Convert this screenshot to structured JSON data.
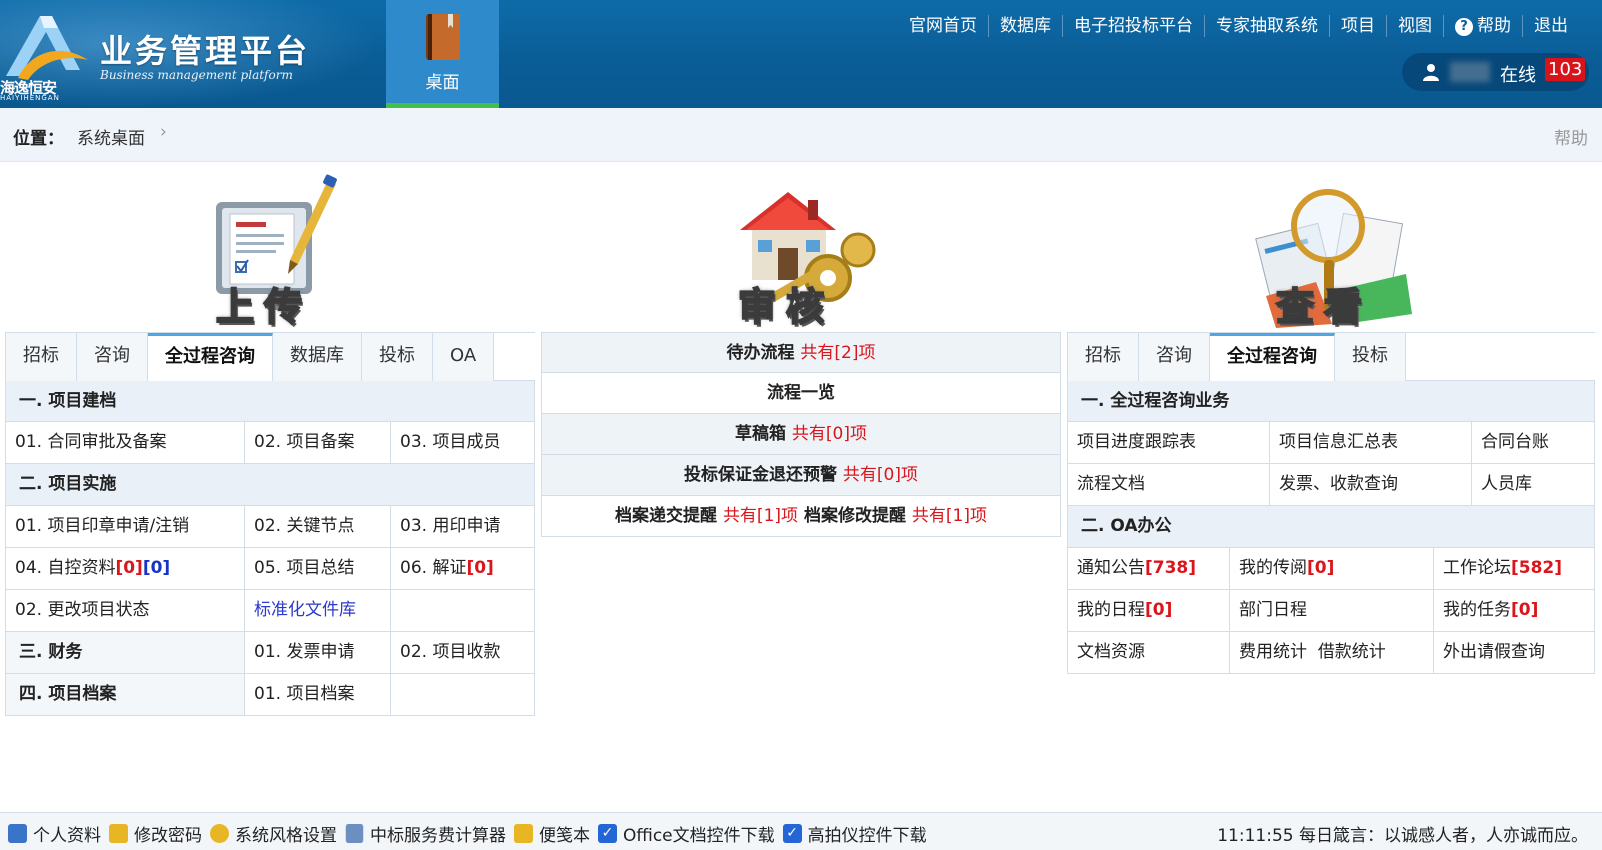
{
  "header": {
    "brand_title": "业务管理平台",
    "brand_subtitle": "Business management platform",
    "logo_cn": "海逸恒安",
    "logo_en": "HAIYIHENGAN",
    "desk_tab": "桌面",
    "nav": [
      "官网首页",
      "数据库",
      "电子招投标平台",
      "专家抽取系统",
      "项目",
      "视图",
      "帮助",
      "退出"
    ],
    "online_label": "在线",
    "online_count": "103"
  },
  "breadcrumb": {
    "label": "位置：",
    "value": "系统桌面",
    "chevron": "›",
    "help": "帮助"
  },
  "sections": {
    "upload": "上传",
    "review": "审核",
    "view": "查看"
  },
  "left": {
    "tabs": [
      "招标",
      "咨询",
      "全过程咨询",
      "数据库",
      "投标",
      "OA"
    ],
    "active_tab": 2,
    "h1": "一. 项目建档",
    "r1": [
      "01. 合同审批及备案",
      "02. 项目备案",
      "03. 项目成员"
    ],
    "h2": "二. 项目实施",
    "r2": [
      "01. 项目印章申请/注销",
      "02. 关键节点",
      "03. 用印申请"
    ],
    "r3_a": "04. 自控资料",
    "r3_a1": "[0]",
    "r3_a2": "[0]",
    "r3_b": "05. 项目总结",
    "r3_c": "06. 解证",
    "r3_c1": "[0]",
    "r4": [
      "02. 更改项目状态",
      "标准化文件库"
    ],
    "h3": "三. 财务",
    "r5": [
      "01. 发票申请",
      "02. 项目收款"
    ],
    "h4": "四. 项目档案",
    "r6": [
      "01. 项目档案"
    ]
  },
  "middle": {
    "rows": [
      {
        "label": "待办流程",
        "count": "共有[2]项"
      },
      {
        "label": "流程一览",
        "count": ""
      },
      {
        "label": "草稿箱",
        "count": "共有[0]项"
      },
      {
        "label": "投标保证金退还预警",
        "count": "共有[0]项"
      }
    ],
    "last_a": "档案递交提醒",
    "last_a_count": "共有[1]项",
    "last_b": "档案修改提醒",
    "last_b_count": "共有[1]项"
  },
  "right": {
    "tabs": [
      "招标",
      "咨询",
      "全过程咨询",
      "投标"
    ],
    "active_tab": 2,
    "h1": "一. 全过程咨询业务",
    "r1": [
      "项目进度跟踪表",
      "项目信息汇总表",
      "合同台账"
    ],
    "r2": [
      "流程文档",
      "发票、收款查询",
      "人员库"
    ],
    "h2": "二. OA办公",
    "r3_a": "通知公告",
    "r3_a1": "[738]",
    "r3_b": "我的传阅",
    "r3_b1": "[0]",
    "r3_c": "工作论坛",
    "r3_c1": "[582]",
    "r4_a": "我的日程",
    "r4_a1": "[0]",
    "r4_b": "部门日程",
    "r4_c": "我的任务",
    "r4_c1": "[0]",
    "r5_a": "文档资源",
    "r5_b1": "费用统计",
    "r5_b2": "借款统计",
    "r5_c": "外出请假查询"
  },
  "footer": {
    "items": [
      "个人资料",
      "修改密码",
      "系统风格设置",
      "中标服务费计算器",
      "便笺本",
      "Office文档控件下载",
      "高拍仪控件下载"
    ],
    "time": "11:11:55",
    "motto": "每日箴言：以诚感人者，人亦诚而应。"
  },
  "colors": {
    "header_bg": "#0a5d97",
    "accent_green": "#44c04a",
    "count_red": "#d9161b",
    "link_blue": "#2b38c9"
  }
}
